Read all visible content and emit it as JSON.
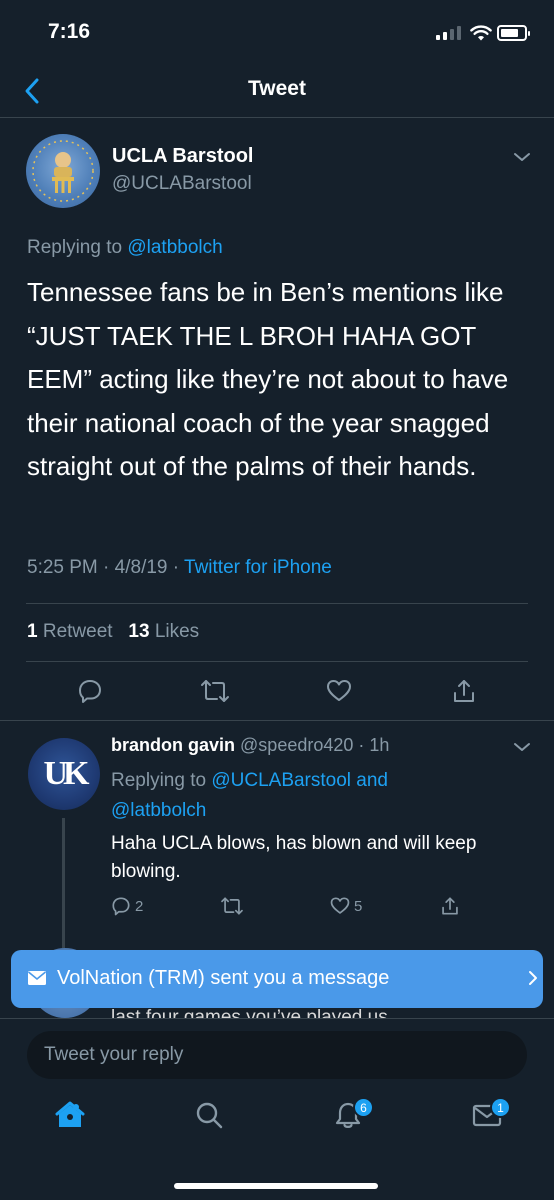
{
  "status": {
    "time": "7:16"
  },
  "nav": {
    "title": "Tweet"
  },
  "tweet": {
    "author_name": "UCLA Barstool",
    "author_handle": "@UCLABarstool",
    "replying_prefix": "Replying to ",
    "replying_to": "@latbbolch",
    "text": "Tennessee fans be in Ben’s mentions like “JUST TAEK THE L BROH HAHA GOT EEM” acting like they’re not about to have their national coach of the year snagged straight out of the palms of their hands.",
    "time": "5:25 PM",
    "sep1": " · ",
    "date": "4/8/19",
    "sep2": " · ",
    "source": "Twitter for iPhone",
    "retweets": "1",
    "retweets_label": "Retweet",
    "likes": "13",
    "likes_label": "Likes"
  },
  "reply": {
    "name": "brandon gavin",
    "handle": "@speedro420",
    "sep": " · ",
    "time": "1h",
    "replying_prefix": "Replying to ",
    "replying_to_1": "@UCLABarstool",
    "replying_and": " and",
    "replying_to_2": "@latbbolch",
    "text": "Haha UCLA blows, has blown and will keep blowing.",
    "reply_count": "2",
    "like_count": "5",
    "avatar_text": "UK"
  },
  "partial_reply": {
    "text": "last four games you’ve played us"
  },
  "toast": {
    "text": "VolNation (TRM) sent you a message"
  },
  "composer": {
    "placeholder": "Tweet your reply"
  },
  "tabbar": {
    "notifications_badge": "6",
    "messages_badge": "1"
  },
  "colors": {
    "background": "#15202b",
    "accent": "#1da1f2",
    "secondary_text": "#8899a6",
    "toast": "#4a99e9"
  },
  "icons": [
    "back-chevron-icon",
    "caret-down-icon",
    "reply-icon",
    "retweet-icon",
    "like-icon",
    "share-icon",
    "mail-icon",
    "chevron-right-icon",
    "home-icon",
    "search-icon",
    "bell-icon",
    "messages-icon"
  ]
}
